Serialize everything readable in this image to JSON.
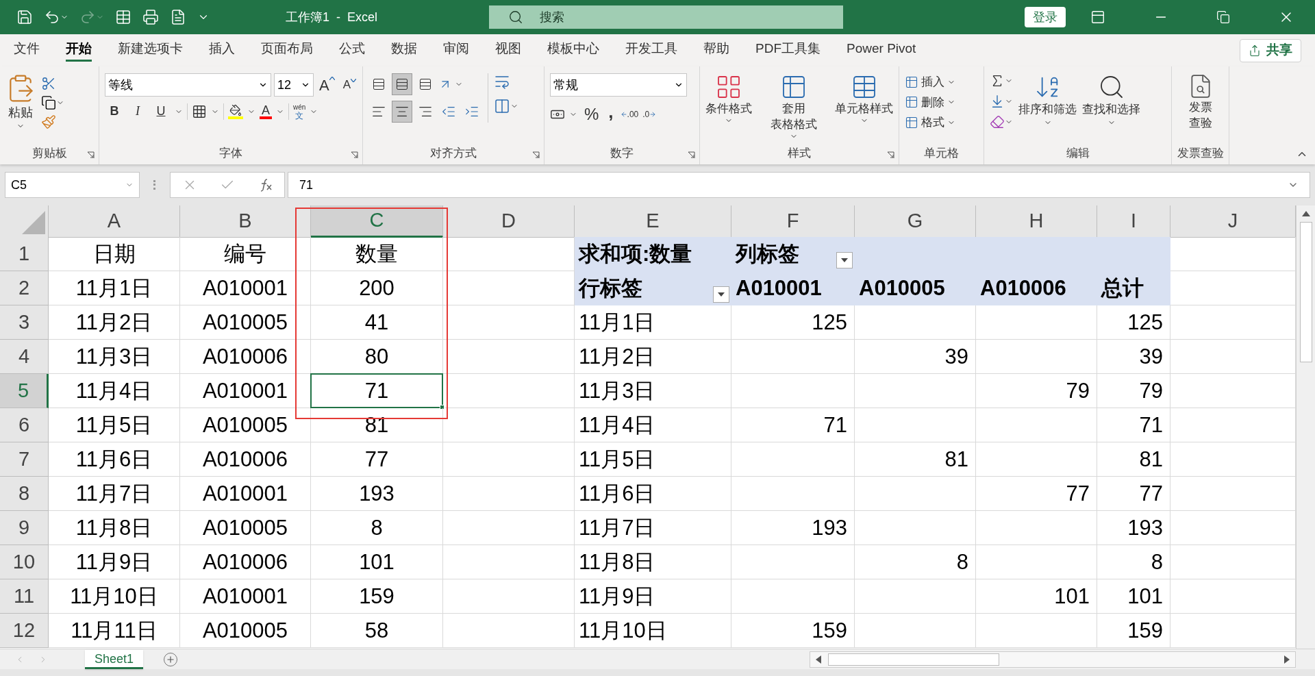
{
  "title_bar": {
    "title": "工作簿1  -  Excel",
    "search": {
      "placeholder": "搜索"
    },
    "sign_in": "登录"
  },
  "ribbon_tabs": [
    {
      "label": "文件",
      "selected": false
    },
    {
      "label": "开始",
      "selected": true
    },
    {
      "label": "新建选项卡",
      "selected": false
    },
    {
      "label": "插入",
      "selected": false
    },
    {
      "label": "页面布局",
      "selected": false
    },
    {
      "label": "公式",
      "selected": false
    },
    {
      "label": "数据",
      "selected": false
    },
    {
      "label": "审阅",
      "selected": false
    },
    {
      "label": "视图",
      "selected": false
    },
    {
      "label": "模板中心",
      "selected": false
    },
    {
      "label": "开发工具",
      "selected": false
    },
    {
      "label": "帮助",
      "selected": false
    },
    {
      "label": "PDF工具集",
      "selected": false
    },
    {
      "label": "Power Pivot",
      "selected": false
    }
  ],
  "share_button": "共享",
  "ribbon": {
    "groups": [
      {
        "kind": "clipboard",
        "label": "剪贴板",
        "paste": "粘贴"
      },
      {
        "kind": "font",
        "label": "字体",
        "font_name": "等线",
        "font_size": "12",
        "grow": "A",
        "shrink": "A",
        "bold": "B",
        "italic": "I",
        "underline": "U",
        "font_color": "A",
        "phonetic": "wén",
        "phonetic_char": "文"
      },
      {
        "kind": "alignment",
        "label": "对齐方式"
      },
      {
        "kind": "number",
        "label": "数字",
        "format": "常规",
        "percent": "%",
        "comma": ",",
        "increase_decimal": ".00",
        "decrease_decimal": ".0"
      },
      {
        "kind": "styles",
        "label": "样式",
        "buttons": [
          [
            "条件格式"
          ],
          [
            "套用",
            "表格格式"
          ],
          [
            "单元格样式"
          ]
        ]
      },
      {
        "kind": "cells",
        "label": "单元格",
        "buttons": [
          "插入",
          "删除",
          "格式"
        ]
      },
      {
        "kind": "editing",
        "label": "编辑",
        "buttons": [
          "排序和筛选",
          "查找和选择"
        ]
      },
      {
        "kind": "invoice",
        "label": "发票查验",
        "button": [
          "发票",
          "查验"
        ]
      }
    ]
  },
  "formula_bar": {
    "name_box": "C5",
    "formula": "71"
  },
  "sheet": {
    "columns": [
      {
        "label": "A",
        "selected": false
      },
      {
        "label": "B",
        "selected": false
      },
      {
        "label": "C",
        "selected": true
      },
      {
        "label": "D",
        "selected": false
      },
      {
        "label": "E",
        "selected": false
      },
      {
        "label": "F",
        "selected": false
      },
      {
        "label": "G",
        "selected": false
      },
      {
        "label": "H",
        "selected": false
      },
      {
        "label": "I",
        "selected": false
      },
      {
        "label": "J",
        "selected": false
      }
    ],
    "rows": [
      {
        "number": "1",
        "selected": false,
        "kind": "pivot_column_header",
        "cells": [
          "日期",
          "编号",
          "数量",
          "",
          "求和项:数量",
          "列标签",
          "",
          "",
          "",
          ""
        ]
      },
      {
        "number": "2",
        "selected": false,
        "kind": "pivot_row_header",
        "cells": [
          "11月1日",
          "A010001",
          "200",
          "",
          "行标签",
          "A010001",
          "A010005",
          "A010006",
          "总计",
          ""
        ]
      },
      {
        "number": "3",
        "selected": false,
        "kind": "data",
        "cells": [
          "11月2日",
          "A010005",
          "41",
          "",
          "11月1日",
          "125",
          "",
          "",
          "125",
          ""
        ]
      },
      {
        "number": "4",
        "selected": false,
        "kind": "data",
        "cells": [
          "11月3日",
          "A010006",
          "80",
          "",
          "11月2日",
          "",
          "39",
          "",
          "39",
          ""
        ]
      },
      {
        "number": "5",
        "selected": true,
        "kind": "data",
        "cells": [
          "11月4日",
          "A010001",
          "71",
          "",
          "11月3日",
          "",
          "",
          "79",
          "79",
          ""
        ]
      },
      {
        "number": "6",
        "selected": false,
        "kind": "data",
        "cells": [
          "11月5日",
          "A010005",
          "81",
          "",
          "11月4日",
          "71",
          "",
          "",
          "71",
          ""
        ]
      },
      {
        "number": "7",
        "selected": false,
        "kind": "data",
        "cells": [
          "11月6日",
          "A010006",
          "77",
          "",
          "11月5日",
          "",
          "81",
          "",
          "81",
          ""
        ]
      },
      {
        "number": "8",
        "selected": false,
        "kind": "data",
        "cells": [
          "11月7日",
          "A010001",
          "193",
          "",
          "11月6日",
          "",
          "",
          "77",
          "77",
          ""
        ]
      },
      {
        "number": "9",
        "selected": false,
        "kind": "data",
        "cells": [
          "11月8日",
          "A010005",
          "8",
          "",
          "11月7日",
          "193",
          "",
          "",
          "193",
          ""
        ]
      },
      {
        "number": "10",
        "selected": false,
        "kind": "data",
        "cells": [
          "11月9日",
          "A010006",
          "101",
          "",
          "11月8日",
          "",
          "8",
          "",
          "8",
          ""
        ]
      },
      {
        "number": "11",
        "selected": false,
        "kind": "data",
        "cells": [
          "11月10日",
          "A010001",
          "159",
          "",
          "11月9日",
          "",
          "",
          "101",
          "101",
          ""
        ]
      },
      {
        "number": "12",
        "selected": false,
        "kind": "data",
        "cells": [
          "11月11日",
          "A010005",
          "58",
          "",
          "11月10日",
          "159",
          "",
          "",
          "159",
          ""
        ]
      }
    ]
  },
  "sheet_tabs": [
    {
      "label": "Sheet1",
      "selected": true
    }
  ]
}
